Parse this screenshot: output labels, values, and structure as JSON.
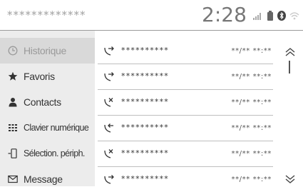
{
  "header": {
    "title": "*************",
    "clock": "2:28",
    "icons": [
      "signal-bars-icon",
      "battery-icon",
      "bluetooth-icon",
      "wifi-icon"
    ]
  },
  "sidebar": {
    "items": [
      {
        "label": "Historique",
        "icon": "clock-icon",
        "active": true
      },
      {
        "label": "Favoris",
        "icon": "star-icon",
        "active": false
      },
      {
        "label": "Contacts",
        "icon": "person-icon",
        "active": false
      },
      {
        "label": "Clavier numérique",
        "icon": "keypad-icon",
        "active": false
      },
      {
        "label": "Sélection. périph.",
        "icon": "phone-device-icon",
        "active": false
      },
      {
        "label": "Message",
        "icon": "envelope-icon",
        "active": false
      }
    ]
  },
  "calls": [
    {
      "type": "outgoing",
      "number": "**********",
      "datetime": "**/** **:**"
    },
    {
      "type": "outgoing",
      "number": "**********",
      "datetime": "**/** **:**"
    },
    {
      "type": "missed",
      "number": "**********",
      "datetime": "**/** **:**"
    },
    {
      "type": "incoming",
      "number": "**********",
      "datetime": "**/** **:**"
    },
    {
      "type": "missed",
      "number": "**********",
      "datetime": "**/** **:**"
    },
    {
      "type": "outgoing",
      "number": "**********",
      "datetime": "**/** **:**"
    }
  ],
  "colors": {
    "sidebar_bg": "#ececec",
    "active_bg": "#d9d9d9",
    "divider": "#bfbfbf"
  }
}
